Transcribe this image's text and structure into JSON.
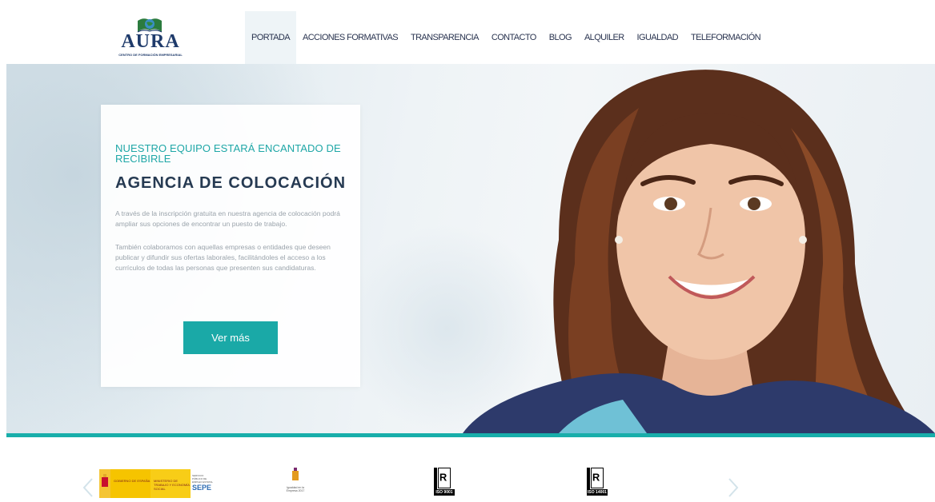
{
  "brand": {
    "name": "AURA",
    "tagline": "CENTRO DE FORMACIÓN EMPRESARIAL"
  },
  "nav": {
    "items": [
      {
        "label": "PORTADA",
        "active": true
      },
      {
        "label": "ACCIONES FORMATIVAS",
        "active": false
      },
      {
        "label": "TRANSPARENCIA",
        "active": false
      },
      {
        "label": "CONTACTO",
        "active": false
      },
      {
        "label": "BLOG",
        "active": false
      },
      {
        "label": "ALQUILER",
        "active": false
      },
      {
        "label": "IGUALDAD",
        "active": false
      },
      {
        "label": "TELEFORMACIÓN",
        "active": false
      }
    ]
  },
  "hero": {
    "kicker": "NUESTRO EQUIPO ESTARÁ ENCANTADO DE RECIBIRLE",
    "title": "AGENCIA DE COLOCACIÓN",
    "paragraph1": "A través de la inscripción gratuita en nuestra agencia de colocación podrá ampliar sus opciones de encontrar un puesto de trabajo.",
    "paragraph2": "También colaboramos con aquellas empresas o entidades que deseen publicar y difundir sus ofertas laborales, facilitándoles el acceso a los currículos de todas las personas que presenten sus candidaturas.",
    "button_label": "Ver más"
  },
  "partners": {
    "gobierno_line1": "GOBIERNO DE ESPAÑA",
    "ministerio": "MINISTERIO DE TRABAJO Y ECONOMÍA SOCIAL",
    "sepe_small": "SERVICIO PÚBLICO DE EMPLEO ESTATAL",
    "sepe": "SEPE",
    "igualdad": "Igualdad en la Empresa 2017",
    "iso1": "ISO 9001",
    "iso2": "ISO 14001"
  },
  "colors": {
    "accent": "#1aa9a7",
    "navy": "#263a52",
    "nav_text": "#2a3450"
  }
}
